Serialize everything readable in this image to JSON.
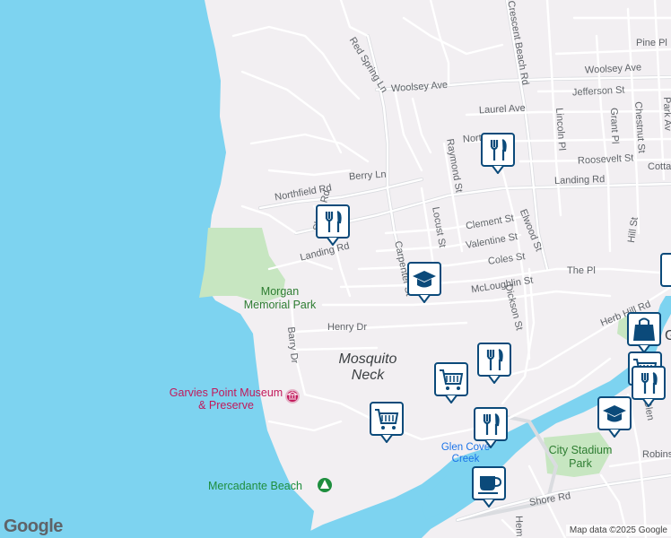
{
  "map": {
    "colors": {
      "land": "#f2eff2",
      "water": "#7dd3f0",
      "park": "#c7e6c1",
      "road": "#ffffff",
      "road_edge": "#dadce0",
      "marker": "#0b4a7a"
    },
    "streets": [
      "Red Spring Ln",
      "Woolsey Ave",
      "Woolsey Ave",
      "Crescent Beach Rd",
      "Pine Pl",
      "Jefferson St",
      "Laurel Ave",
      "Lincoln Pl",
      "Grant Pl",
      "Chestnut St",
      "Park Av",
      "North St",
      "Roosevelt St",
      "Cottag",
      "Raymond St",
      "Berry Ln",
      "Northfield Rd",
      "Landing Rd",
      "Landing Rd",
      "Shore Rd",
      "Clement St",
      "Elwood St",
      "Hill St",
      "Valentine St",
      "Locust St",
      "Carpenter St",
      "Coles St",
      "The Pl",
      "McLoughlin St",
      "Herb Hill Rd",
      "Dickson St",
      "Henry Dr",
      "Barry Dr",
      "Shore Rd",
      "Robins",
      "Glen",
      "Hem"
    ],
    "places": {
      "neighborhood": "Mosquito Neck",
      "park": "Morgan Memorial Park",
      "museum": "Garvies Point Museum & Preserve",
      "beach": "Mercadante Beach",
      "creek": "Glen Cove Creek",
      "stadium_park": "City Stadium Park",
      "edge_label": "G"
    },
    "markers": [
      {
        "icon": "restaurant-icon"
      },
      {
        "icon": "restaurant-icon"
      },
      {
        "icon": "school-icon"
      },
      {
        "icon": "restaurant-icon"
      },
      {
        "icon": "shopping-cart-icon"
      },
      {
        "icon": "shopping-cart-icon"
      },
      {
        "icon": "restaurant-icon"
      },
      {
        "icon": "cafe-icon"
      },
      {
        "icon": "shopping-bag-icon"
      },
      {
        "icon": "shopping-cart-icon"
      },
      {
        "icon": "restaurant-icon"
      },
      {
        "icon": "school-icon"
      }
    ],
    "logo": "Google",
    "attribution": "Map data ©2025 Google"
  }
}
